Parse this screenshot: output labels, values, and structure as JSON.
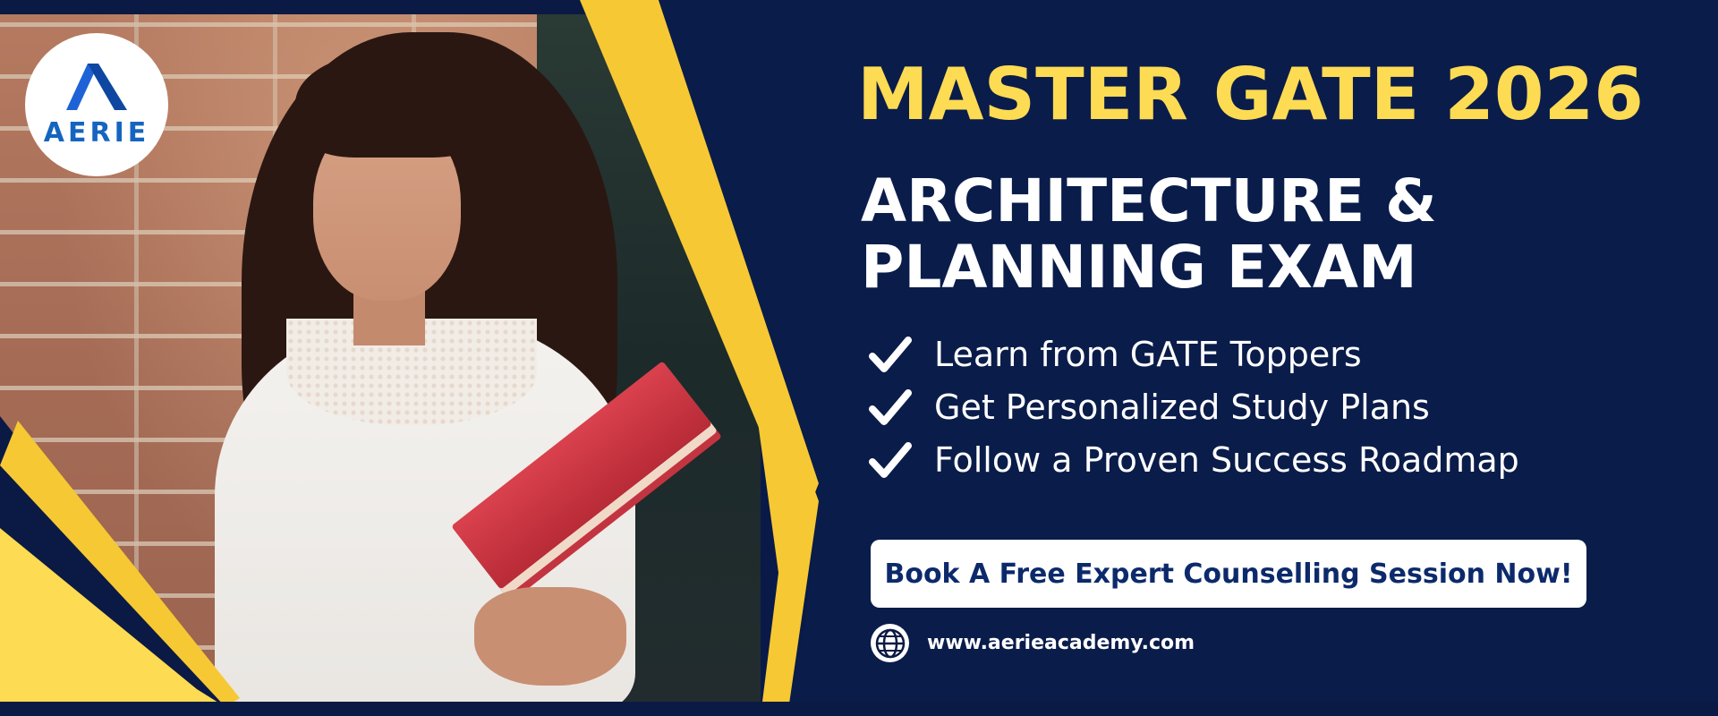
{
  "brand": {
    "logo_text": "AERIE",
    "logo_icon": "aerie-a-icon",
    "logo_color": "#1565c0"
  },
  "headline": "MASTER GATE 2026",
  "subheadline": {
    "line1": "ARCHITECTURE &",
    "line2": "PLANNING EXAM"
  },
  "features": [
    {
      "icon": "check-icon",
      "text": "Learn from GATE Toppers"
    },
    {
      "icon": "check-icon",
      "text": "Get Personalized Study Plans"
    },
    {
      "icon": "check-icon",
      "text": "Follow a Proven Success Roadmap"
    }
  ],
  "cta": {
    "label": "Book A Free Expert Counselling Session Now!"
  },
  "website": {
    "icon": "globe-icon",
    "url": "www.aerieacademy.com"
  },
  "colors": {
    "navy": "#0b1a44",
    "accent_yellow": "#fddb53",
    "cta_text": "#0c2a6b",
    "white": "#ffffff"
  }
}
